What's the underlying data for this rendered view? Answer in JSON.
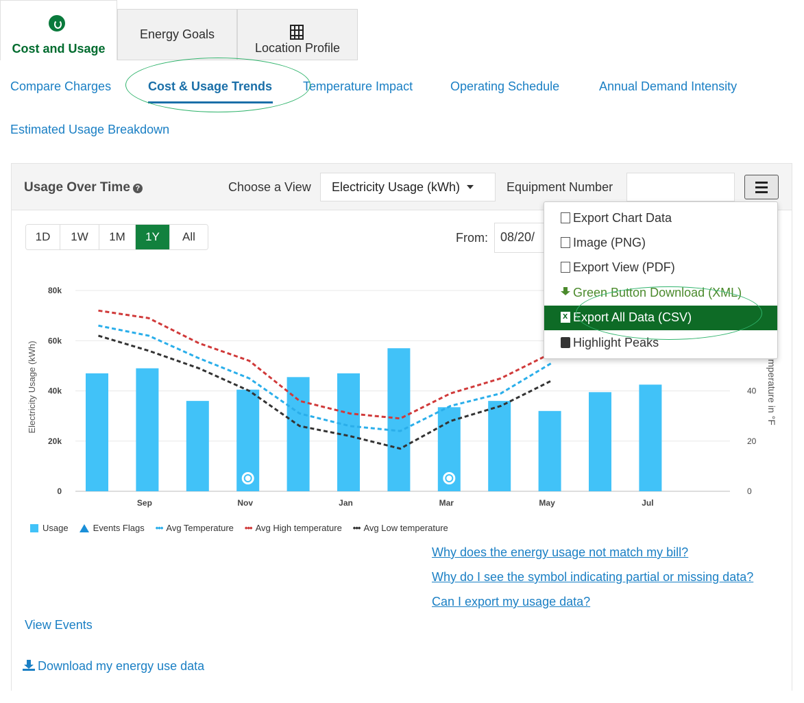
{
  "top_tabs": [
    {
      "label": "Cost and Usage",
      "icon": "gauge-icon",
      "active": true
    },
    {
      "label": "Energy Goals",
      "active": false
    },
    {
      "label": "Location Profile",
      "icon": "building-icon",
      "active": false
    }
  ],
  "subnav": [
    {
      "label": "Compare Charges"
    },
    {
      "label": "Cost & Usage Trends",
      "active": true
    },
    {
      "label": "Temperature Impact"
    },
    {
      "label": "Operating Schedule"
    },
    {
      "label": "Annual Demand Intensity"
    },
    {
      "label": "Estimated Usage Breakdown"
    }
  ],
  "panel": {
    "title": "Usage Over Time",
    "help_icon": "?",
    "choose_view_label": "Choose a View",
    "view_value": "Electricity Usage (kWh)",
    "equipment_label": "Equipment Number",
    "equipment_value": "",
    "range_buttons": [
      "1D",
      "1W",
      "1M",
      "1Y",
      "All"
    ],
    "active_range": "1Y",
    "from_label": "From:",
    "from_value": "08/20/"
  },
  "menu": {
    "items": [
      {
        "label": "Export Chart Data",
        "icon": "document-icon"
      },
      {
        "label": "Image (PNG)",
        "icon": "image-icon"
      },
      {
        "label": "Export View (PDF)",
        "icon": "pdf-icon"
      },
      {
        "label": "Green Button Download (XML)",
        "icon": "download-icon",
        "color": "#4b8a2c"
      },
      {
        "label": "Export All Data (CSV)",
        "icon": "excel-icon",
        "selected": true
      },
      {
        "label": "Highlight Peaks",
        "icon": "pencil-icon"
      }
    ]
  },
  "chart_data": {
    "type": "bar",
    "ylabel": "Electricity Usage (kWh)",
    "y2label": "Temperature in °F",
    "ylim": [
      0,
      80000
    ],
    "y2lim": [
      0,
      80
    ],
    "ytick_labels": [
      "0",
      "20k",
      "40k",
      "60k",
      "80k"
    ],
    "y2tick_labels": [
      "0",
      "20",
      "40"
    ],
    "xtick_labels": [
      "Sep",
      "Nov",
      "Jan",
      "Mar",
      "May",
      "Jul"
    ],
    "legend_position": "bottom-left",
    "usage": [
      47000,
      49000,
      36000,
      40500,
      45500,
      47000,
      57000,
      33500,
      36000,
      32000,
      39500,
      42500
    ],
    "event_flags": [
      3,
      7
    ],
    "series": [
      {
        "name": "Avg Temperature",
        "color": "#2aaeea",
        "values": [
          66,
          62,
          53,
          45,
          31,
          26,
          24,
          34,
          39,
          51,
          null,
          null
        ]
      },
      {
        "name": "Avg High temperature",
        "color": "#d03a3a",
        "values": [
          72,
          69,
          59,
          52,
          36,
          31,
          29,
          39,
          45,
          55,
          null,
          null
        ]
      },
      {
        "name": "Avg Low temperature",
        "color": "#333333",
        "values": [
          62,
          56,
          49,
          40,
          26,
          22,
          17,
          28,
          34,
          44,
          null,
          null
        ]
      }
    ],
    "legend": [
      "Usage",
      "Events Flags",
      "Avg Temperature",
      "Avg High temperature",
      "Avg Low temperature"
    ],
    "colors": {
      "bar": "#41c2f8",
      "event": "#1a8fd8"
    }
  },
  "faq_links": [
    "Why does the energy usage not match my bill?",
    "Why do I see the symbol indicating partial or missing data?",
    "Can I export my usage data?"
  ],
  "view_events": "View Events",
  "download_link": "Download my energy use data"
}
